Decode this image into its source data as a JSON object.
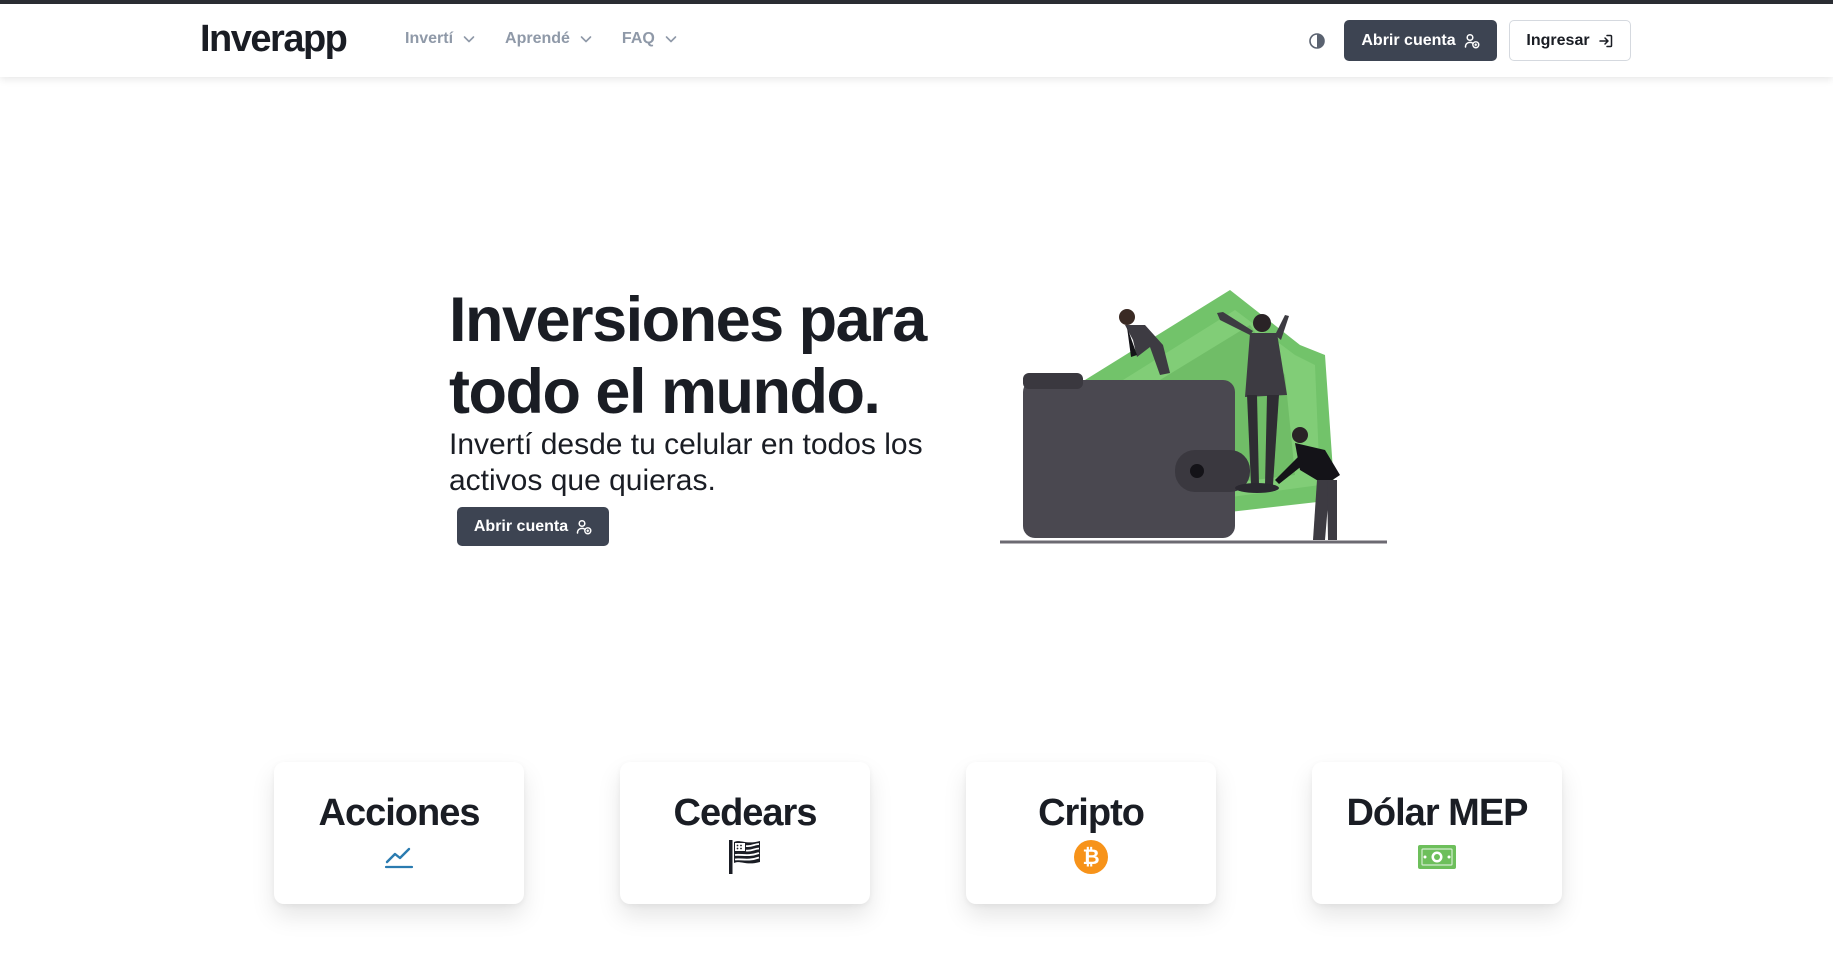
{
  "brand": {
    "logo_text": "Inverapp"
  },
  "nav": {
    "items": [
      {
        "label": "Invertí",
        "icon": "chevron-down-icon"
      },
      {
        "label": "Aprendé",
        "icon": "chevron-down-icon"
      },
      {
        "label": "FAQ",
        "icon": "chevron-down-icon"
      }
    ],
    "theme_toggle_icon": "contrast-icon",
    "open_account_label": "Abrir cuenta",
    "open_account_icon": "user-add-icon",
    "login_label": "Ingresar",
    "login_icon": "login-icon"
  },
  "hero": {
    "title_line1": "Inversiones para",
    "title_line2": "todo el mundo.",
    "subtitle_line1": "Invertí desde tu celular en todos los",
    "subtitle_line2": "activos que quieras.",
    "cta_label": "Abrir cuenta",
    "illustration": "wallet-with-money-people-illustration"
  },
  "cards": [
    {
      "title": "Acciones",
      "icon": "line-chart-icon",
      "icon_color": "#2a7bb0"
    },
    {
      "title": "Cedears",
      "icon": "us-flag-icon",
      "icon_color": "#1a1d24"
    },
    {
      "title": "Cripto",
      "icon": "bitcoin-icon",
      "icon_color": "#f7931a"
    },
    {
      "title": "Dólar MEP",
      "icon": "banknote-icon",
      "icon_color": "#6dbf5b"
    }
  ],
  "colors": {
    "primary_button": "#3d4452",
    "nav_text": "#8f99a8",
    "heading": "#1a1d24",
    "money_green": "#6dbf5b"
  }
}
